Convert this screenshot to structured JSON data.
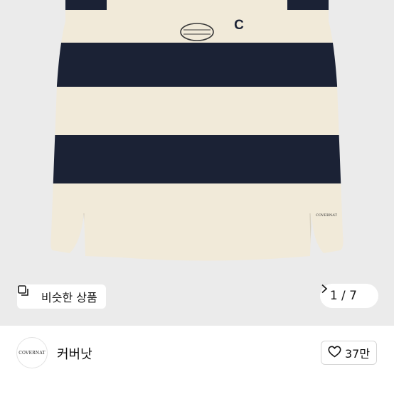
{
  "gallery": {
    "similar_button_label": "비슷한 상품",
    "page_counter": "1 / 7",
    "product_colors": {
      "cream": "#f1ead9",
      "navy": "#1b2235",
      "background": "#ebebeb"
    },
    "badge_letter": "C"
  },
  "shop": {
    "logo_text": "COVERNAT",
    "name": "커버낫",
    "like_count": "37만"
  },
  "icons": {
    "similar": "similar-items-icon",
    "next": "chevron-right-icon",
    "like": "heart-outline-icon"
  }
}
